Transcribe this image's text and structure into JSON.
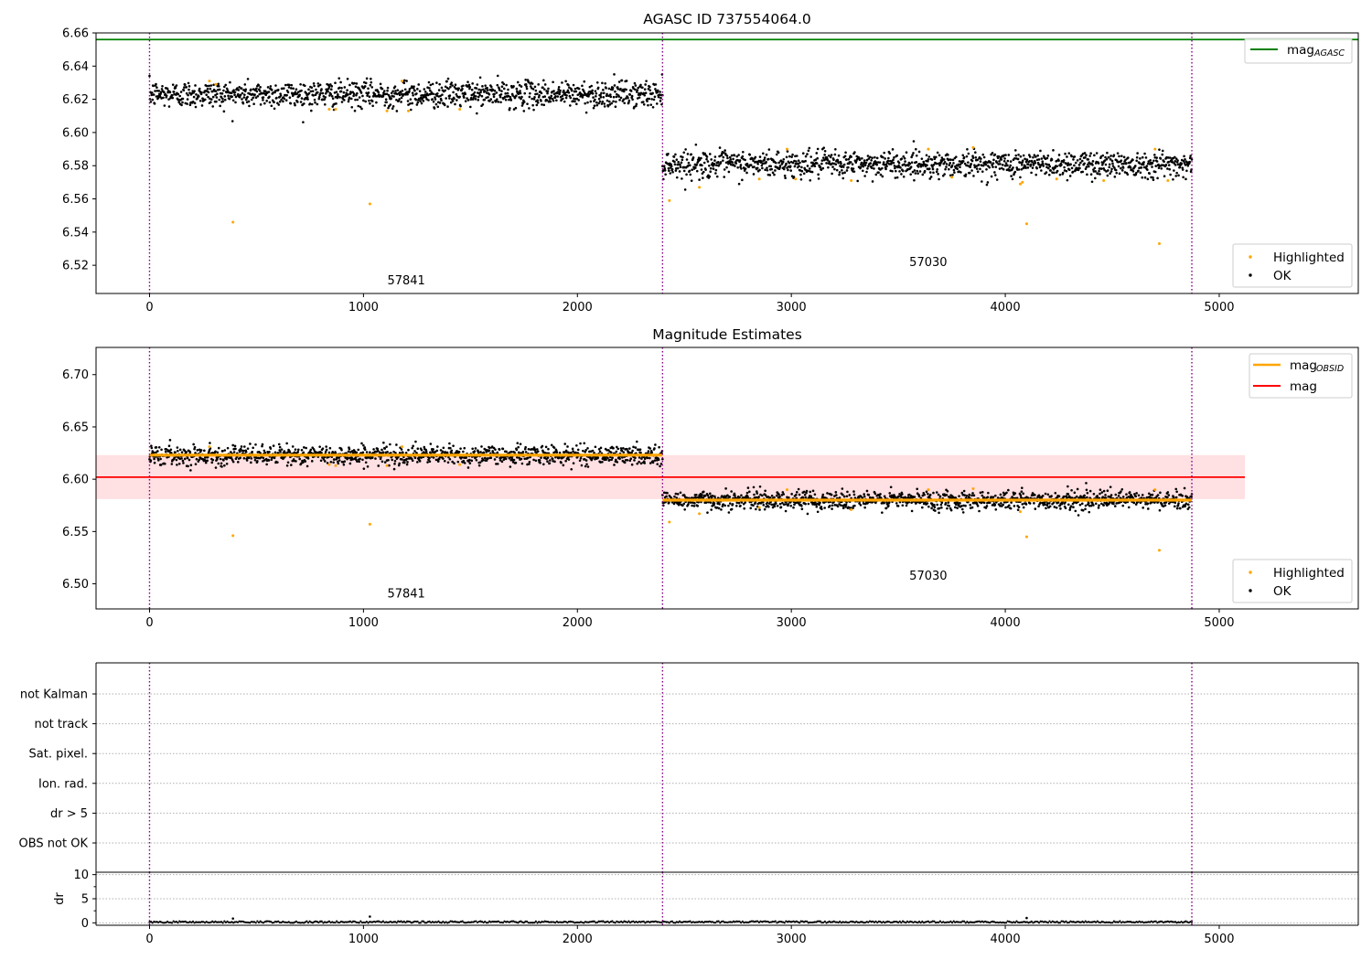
{
  "colors": {
    "ok": "#000000",
    "highlighted": "#ffa500",
    "mag_agasc": "#008000",
    "mag_obsid": "#ffa500",
    "mag": "#ff0000",
    "mag_band": "#ffe0e3",
    "obsid_boundary": "#800080",
    "grid": "#b0b0b0"
  },
  "chart_data": [
    {
      "type": "scatter",
      "title": "AGASC ID 737554064.0",
      "xlim": [
        -250,
        5650
      ],
      "ylim": [
        6.503,
        6.66
      ],
      "xticks": [
        0,
        1000,
        2000,
        3000,
        4000,
        5000
      ],
      "yticks": [
        6.52,
        6.54,
        6.56,
        6.58,
        6.6,
        6.62,
        6.64,
        6.66
      ],
      "ytick_labels": [
        "6.52",
        "6.54",
        "6.56",
        "6.58",
        "6.60",
        "6.62",
        "6.64",
        "6.66"
      ],
      "obsid_boundaries": [
        0,
        2398,
        4872
      ],
      "lines": [
        {
          "name": "mag",
          "sub": "AGASC",
          "y": 6.656,
          "x": [
            -250,
            5650
          ],
          "color_key": "mag_agasc"
        }
      ],
      "band": null,
      "segments": [
        {
          "x_range": [
            0,
            2398
          ],
          "center": 6.623,
          "spread": 0.004
        },
        {
          "x_range": [
            2398,
            4872
          ],
          "center": 6.581,
          "spread": 0.004
        }
      ],
      "highlighted_points": [
        [
          390,
          6.546
        ],
        [
          1030,
          6.557
        ],
        [
          2430,
          6.559
        ],
        [
          2570,
          6.567
        ],
        [
          4100,
          6.545
        ],
        [
          4720,
          6.533
        ],
        [
          280,
          6.631
        ],
        [
          310,
          6.629
        ],
        [
          1180,
          6.631
        ],
        [
          840,
          6.614
        ],
        [
          870,
          6.614
        ],
        [
          1110,
          6.613
        ],
        [
          1210,
          6.613
        ],
        [
          1450,
          6.614
        ],
        [
          2850,
          6.572
        ],
        [
          2980,
          6.59
        ],
        [
          3020,
          6.572
        ],
        [
          3280,
          6.571
        ],
        [
          3640,
          6.59
        ],
        [
          3750,
          6.573
        ],
        [
          3850,
          6.591
        ],
        [
          4070,
          6.569
        ],
        [
          4080,
          6.57
        ],
        [
          4240,
          6.572
        ],
        [
          4460,
          6.571
        ],
        [
          4700,
          6.59
        ],
        [
          4760,
          6.571
        ]
      ],
      "obsid_labels": [
        {
          "text": "57841",
          "x": 1200,
          "y": 6.5085
        },
        {
          "text": "57030",
          "x": 3640,
          "y": 6.5195
        }
      ],
      "legends": [
        {
          "position": "upper-right",
          "items": [
            {
              "label": "mag",
              "sub": "AGASC",
              "kind": "line",
              "color_key": "mag_agasc"
            }
          ]
        },
        {
          "position": "lower-right",
          "items": [
            {
              "label": "Highlighted",
              "kind": "point",
              "color_key": "highlighted"
            },
            {
              "label": "OK",
              "kind": "point",
              "color_key": "ok"
            }
          ]
        }
      ]
    },
    {
      "type": "scatter",
      "title": "Magnitude Estimates",
      "xlim": [
        -250,
        5650
      ],
      "ylim": [
        6.476,
        6.726
      ],
      "xticks": [
        0,
        1000,
        2000,
        3000,
        4000,
        5000
      ],
      "yticks": [
        6.5,
        6.55,
        6.6,
        6.65,
        6.7
      ],
      "ytick_labels": [
        "6.50",
        "6.55",
        "6.60",
        "6.65",
        "6.70"
      ],
      "obsid_boundaries": [
        0,
        2398,
        4872
      ],
      "lines": [
        {
          "name": "mag",
          "y": 6.602,
          "x": [
            -250,
            5120
          ],
          "color_key": "mag"
        },
        {
          "name": "mag",
          "sub": "OBSID",
          "y": 6.623,
          "x": [
            0,
            2398
          ],
          "color_key": "mag_obsid"
        },
        {
          "name": "mag",
          "sub": "OBSID",
          "y": 6.58,
          "x": [
            2398,
            4872
          ],
          "color_key": "mag_obsid"
        }
      ],
      "band": {
        "x": [
          -250,
          5120
        ],
        "y": [
          6.581,
          6.623
        ],
        "color_key": "mag_band"
      },
      "segments": [
        {
          "x_range": [
            0,
            2398
          ],
          "center": 6.623,
          "spread": 0.0045
        },
        {
          "x_range": [
            2398,
            4872
          ],
          "center": 6.58,
          "spread": 0.0045
        }
      ],
      "highlighted_points": [
        [
          390,
          6.546
        ],
        [
          1030,
          6.557
        ],
        [
          2430,
          6.559
        ],
        [
          2570,
          6.567
        ],
        [
          4100,
          6.545
        ],
        [
          4720,
          6.532
        ],
        [
          280,
          6.631
        ],
        [
          1180,
          6.631
        ],
        [
          840,
          6.614
        ],
        [
          870,
          6.613
        ],
        [
          1110,
          6.613
        ],
        [
          1450,
          6.614
        ],
        [
          2850,
          6.573
        ],
        [
          2980,
          6.59
        ],
        [
          3280,
          6.571
        ],
        [
          3640,
          6.59
        ],
        [
          3850,
          6.591
        ],
        [
          4070,
          6.569
        ],
        [
          4700,
          6.59
        ]
      ],
      "obsid_labels": [
        {
          "text": "57841",
          "x": 1200,
          "y": 6.487
        },
        {
          "text": "57030",
          "x": 3640,
          "y": 6.504
        }
      ],
      "legends": [
        {
          "position": "upper-right",
          "items": [
            {
              "label": "mag",
              "sub": "OBSID",
              "kind": "line",
              "color_key": "mag_obsid"
            },
            {
              "label": "mag",
              "kind": "line",
              "color_key": "mag"
            }
          ]
        },
        {
          "position": "lower-right",
          "items": [
            {
              "label": "Highlighted",
              "kind": "point",
              "color_key": "highlighted"
            },
            {
              "label": "OK",
              "kind": "point",
              "color_key": "ok"
            }
          ]
        }
      ]
    },
    {
      "type": "scatter",
      "title": "",
      "xlim": [
        -250,
        5650
      ],
      "obsid_boundaries": [
        0,
        2398,
        4872
      ],
      "flag_labels": [
        "not Kalman",
        "not track",
        "Sat. pixel.",
        "Ion. rad.",
        "dr > 5",
        "OBS not OK"
      ],
      "flag_points": []
    },
    {
      "type": "scatter",
      "title": "",
      "ylabel": "dr",
      "xlim": [
        -250,
        5650
      ],
      "ylim": [
        -0.5,
        10.5
      ],
      "xticks": [
        0,
        1000,
        2000,
        3000,
        4000,
        5000
      ],
      "yticks": [
        0,
        5,
        10
      ],
      "ytick_labels": [
        "0",
        "5",
        "10"
      ],
      "obsid_boundaries": [
        0,
        2398,
        4872
      ],
      "x_range": [
        0,
        4872
      ],
      "typical_dr": [
        0,
        0.35
      ],
      "outliers": [
        [
          390,
          0.9
        ],
        [
          1030,
          1.3
        ],
        [
          4100,
          1.0
        ]
      ]
    }
  ]
}
